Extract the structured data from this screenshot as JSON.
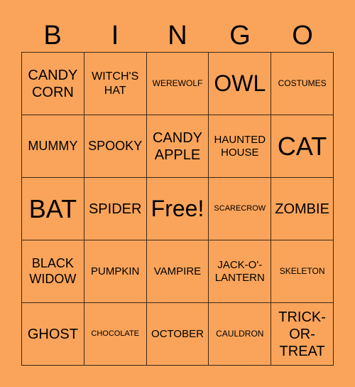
{
  "header": [
    "B",
    "I",
    "N",
    "G",
    "O"
  ],
  "colors": {
    "background": "#F9A45A",
    "grid_line": "#3d2814"
  },
  "cells": [
    [
      "CANDY CORN",
      "WITCH'S HAT",
      "WEREWOLF",
      "OWL",
      "COSTUMES"
    ],
    [
      "MUMMY",
      "SPOOKY",
      "CANDY APPLE",
      "HAUNTED HOUSE",
      "CAT"
    ],
    [
      "BAT",
      "SPIDER",
      "Free!",
      "SCARECROW",
      "ZOMBIE"
    ],
    [
      "BLACK WIDOW",
      "PUMPKIN",
      "VAMPIRE",
      "JACK-O'-LANTERN",
      "SKELETON"
    ],
    [
      "GHOST",
      "CHOCOLATE",
      "OCTOBER",
      "CAULDRON",
      "TRICK-OR-TREAT"
    ]
  ]
}
